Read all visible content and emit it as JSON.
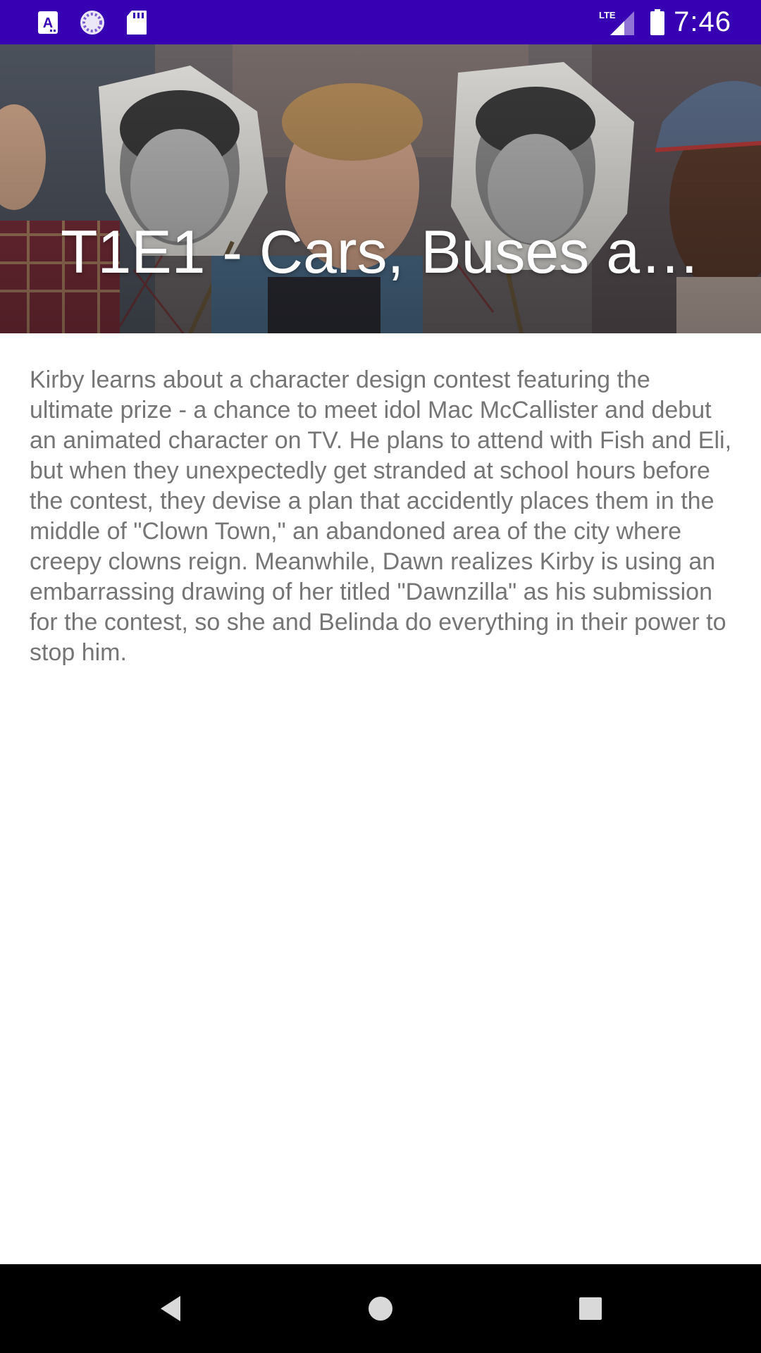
{
  "status_bar": {
    "time": "7:46",
    "icons": [
      "font-app-icon",
      "sync-icon",
      "sd-card-icon",
      "lte-signal-icon",
      "battery-icon"
    ],
    "network_label": "LTE",
    "background_color": "#3700b3"
  },
  "episode": {
    "title": "T1E1 - Cars, Buses a…",
    "description": "Kirby learns about a character design contest featuring the ultimate prize - a chance to meet idol Mac McCallister and debut an animated character on TV. He plans to attend with Fish and Eli, but when they unexpectedly get stranded at school hours before the contest, they devise a plan that accidently places them in the middle of \"Clown Town,\" an abandoned area of the city where creepy clowns reign. Meanwhile, Dawn realizes Kirby is using an embarrassing drawing of her titled \"Dawnzilla\" as his submission for the contest, so she and Belinda do everything in their power to stop him."
  },
  "nav_bar": {
    "buttons": [
      "back-icon",
      "home-icon",
      "recents-icon"
    ]
  },
  "colors": {
    "description_text": "#757575",
    "title_text": "#ffffff",
    "nav_background": "#000000"
  }
}
